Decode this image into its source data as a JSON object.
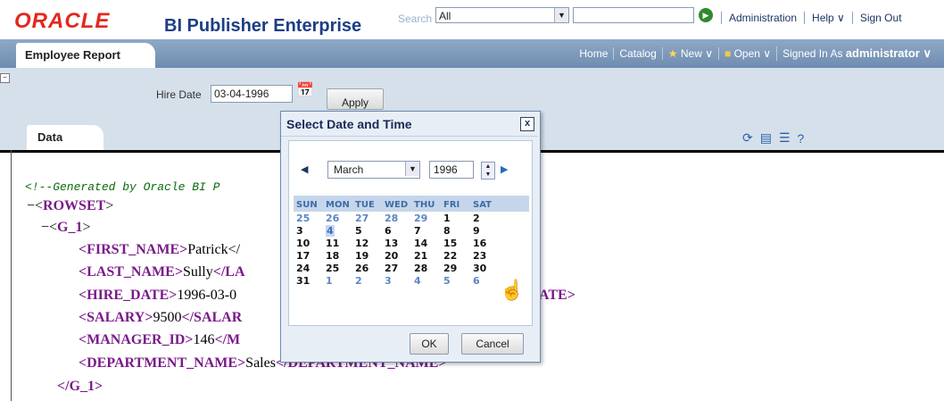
{
  "header": {
    "logo": "ORACLE",
    "app_title": "BI Publisher Enterprise",
    "search_label": "Search",
    "search_scope": "All",
    "search_value": "",
    "links": [
      "Administration",
      "Help ∨",
      "Sign Out"
    ]
  },
  "nav": {
    "tab": "Employee Report",
    "links": [
      "Home",
      "Catalog",
      "New ∨",
      "Open ∨"
    ],
    "signed_in_label": "Signed In As",
    "user": "administrator ∨"
  },
  "params": {
    "hire_date_label": "Hire Date",
    "hire_date_value": "03-04-1996",
    "apply_label": "Apply"
  },
  "data_tab": {
    "label": "Data"
  },
  "xml": {
    "comment": "<!--Generated by Oracle BI P",
    "rowset": "ROWSET",
    "group": "G_1",
    "first_name_tag": "FIRST_NAME",
    "first_name": "Patrick",
    "first_name_close": "</",
    "last_name_tag": "LAST_NAME",
    "last_name": "Sully",
    "last_name_close": "</LA",
    "hire_date_tag": "HIRE_DATE",
    "hire_date": "1996-03-0",
    "hire_date_close": "ATE>",
    "salary_tag": "SALARY",
    "salary": "9500",
    "salary_close": "</SALAR",
    "manager_tag": "MANAGER_ID",
    "manager": "146",
    "manager_close": "</M",
    "dept_tag": "DEPARTMENT_NAME",
    "dept": "Sales",
    "dept_close": "</DEPARTMENT_NAME>",
    "group_close": "</G_1>"
  },
  "dialog": {
    "title": "Select Date and Time",
    "close": "x",
    "month": "March",
    "year": "1996",
    "weekdays": [
      "SUN",
      "MON",
      "TUE",
      "WED",
      "THU",
      "FRI",
      "SAT"
    ],
    "weeks": [
      [
        {
          "d": "25",
          "o": true
        },
        {
          "d": "26",
          "o": true
        },
        {
          "d": "27",
          "o": true
        },
        {
          "d": "28",
          "o": true
        },
        {
          "d": "29",
          "o": true
        },
        {
          "d": "1"
        },
        {
          "d": "2"
        }
      ],
      [
        {
          "d": "3"
        },
        {
          "d": "4",
          "s": true
        },
        {
          "d": "5"
        },
        {
          "d": "6"
        },
        {
          "d": "7"
        },
        {
          "d": "8"
        },
        {
          "d": "9"
        }
      ],
      [
        {
          "d": "10"
        },
        {
          "d": "11"
        },
        {
          "d": "12"
        },
        {
          "d": "13"
        },
        {
          "d": "14"
        },
        {
          "d": "15"
        },
        {
          "d": "16"
        }
      ],
      [
        {
          "d": "17"
        },
        {
          "d": "18"
        },
        {
          "d": "19"
        },
        {
          "d": "20"
        },
        {
          "d": "21"
        },
        {
          "d": "22"
        },
        {
          "d": "23"
        }
      ],
      [
        {
          "d": "24"
        },
        {
          "d": "25"
        },
        {
          "d": "26"
        },
        {
          "d": "27"
        },
        {
          "d": "28"
        },
        {
          "d": "29"
        },
        {
          "d": "30"
        }
      ],
      [
        {
          "d": "31"
        },
        {
          "d": "1",
          "o": true
        },
        {
          "d": "2",
          "o": true
        },
        {
          "d": "3",
          "o": true
        },
        {
          "d": "4",
          "o": true
        },
        {
          "d": "5",
          "o": true
        },
        {
          "d": "6",
          "o": true
        }
      ]
    ],
    "ok_label": "OK",
    "cancel_label": "Cancel"
  }
}
